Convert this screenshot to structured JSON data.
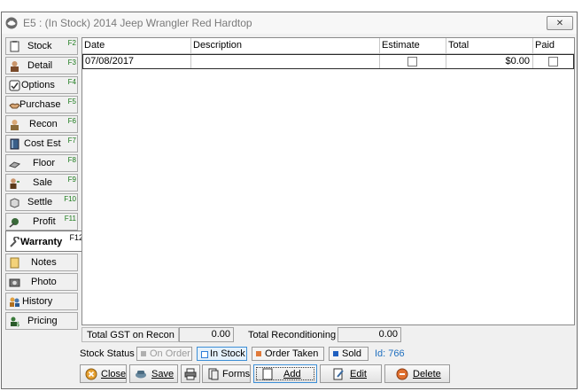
{
  "window": {
    "title": "E5 : (In Stock) 2014 Jeep Wrangler  Red Hardtop",
    "app_icon": "car-icon",
    "close_icon": "close-icon"
  },
  "sidebar": {
    "items": [
      {
        "label": "Stock",
        "key": "F2",
        "icon": "clipboard-icon"
      },
      {
        "label": "Detail",
        "key": "F3",
        "icon": "person-icon"
      },
      {
        "label": "Options",
        "key": "F4",
        "icon": "options-icon"
      },
      {
        "label": "Purchase",
        "key": "F5",
        "icon": "handshake-icon"
      },
      {
        "label": "Recon",
        "key": "F6",
        "icon": "mechanic-icon"
      },
      {
        "label": "Cost Est",
        "key": "F7",
        "icon": "book-icon"
      },
      {
        "label": "Floor",
        "key": "F8",
        "icon": "floor-icon"
      },
      {
        "label": "Sale",
        "key": "F9",
        "icon": "salesperson-icon"
      },
      {
        "label": "Settle",
        "key": "F10",
        "icon": "box-icon"
      },
      {
        "label": "Profit",
        "key": "F11",
        "icon": "profit-icon"
      },
      {
        "label": "Warranty",
        "key": "F12",
        "icon": "wrench-icon",
        "active": true
      },
      {
        "label": "Notes",
        "key": "",
        "icon": "note-icon"
      },
      {
        "label": "Photo",
        "key": "",
        "icon": "camera-icon"
      },
      {
        "label": "History",
        "key": "",
        "icon": "people-icon"
      },
      {
        "label": "Pricing",
        "key": "",
        "icon": "price-tag-icon"
      }
    ]
  },
  "grid": {
    "columns": [
      "Date",
      "Description",
      "Estimate",
      "Total",
      "Paid"
    ],
    "rows": [
      {
        "date": "07/08/2017",
        "description": "",
        "estimate": false,
        "total": "$0.00",
        "paid": false
      }
    ]
  },
  "totals": {
    "gst_label": "Total GST on Recon",
    "gst_value": "0.00",
    "recon_label": "Total Reconditioning",
    "recon_value": "0.00"
  },
  "status": {
    "label": "Stock Status",
    "options": [
      {
        "label": "On Order",
        "color": "#b0b0b0",
        "state": "disabled"
      },
      {
        "label": "In Stock",
        "color": "#2f7ed8",
        "state": "active"
      },
      {
        "label": "Order Taken",
        "color": "#e07a3a",
        "state": "normal"
      },
      {
        "label": "Sold",
        "color": "#1f5fbf",
        "state": "normal"
      }
    ],
    "id_text": "Id: 766"
  },
  "buttons": {
    "close": "Close",
    "save": "Save",
    "print_icon": "printer-icon",
    "forms": "Forms",
    "add": "Add",
    "edit": "Edit",
    "delete": "Delete"
  }
}
